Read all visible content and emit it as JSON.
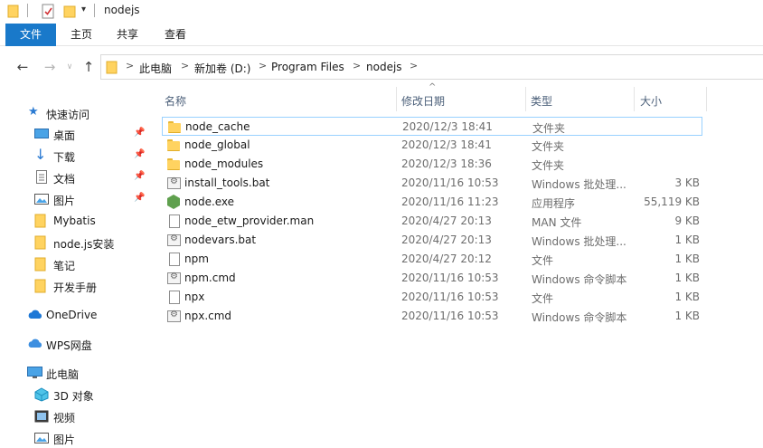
{
  "window": {
    "title": "nodejs"
  },
  "ribbon": {
    "tabs": [
      {
        "label": "文件"
      },
      {
        "label": "主页"
      },
      {
        "label": "共享"
      },
      {
        "label": "查看"
      }
    ]
  },
  "address": {
    "crumbs": [
      "此电脑",
      "新加卷 (D:)",
      "Program Files",
      "nodejs"
    ],
    "separator": ">"
  },
  "nav": {
    "quick_access": "快速访问",
    "items": [
      {
        "label": "桌面",
        "icon": "desktop-icon",
        "pinned": true
      },
      {
        "label": "下载",
        "icon": "download-icon",
        "pinned": true
      },
      {
        "label": "文档",
        "icon": "documents-icon",
        "pinned": true
      },
      {
        "label": "图片",
        "icon": "pictures-icon",
        "pinned": true
      },
      {
        "label": "Mybatis",
        "icon": "folder-icon",
        "pinned": false
      },
      {
        "label": "node.js安装",
        "icon": "folder-icon",
        "pinned": false
      },
      {
        "label": "笔记",
        "icon": "folder-icon",
        "pinned": false
      },
      {
        "label": "开发手册",
        "icon": "folder-icon",
        "pinned": false
      }
    ],
    "onedrive": "OneDrive",
    "wps": "WPS网盘",
    "this_pc": "此电脑",
    "pc_items": [
      {
        "label": "3D 对象",
        "icon": "3d-objects-icon"
      },
      {
        "label": "视频",
        "icon": "videos-icon"
      },
      {
        "label": "图片",
        "icon": "pictures-icon"
      }
    ]
  },
  "columns": {
    "name": "名称",
    "date": "修改日期",
    "type": "类型",
    "size": "大小",
    "sort_caret": "^"
  },
  "files": [
    {
      "name": "node_cache",
      "date": "2020/12/3 18:41",
      "type": "文件夹",
      "size": "",
      "icon": "folder-icon",
      "selected": true
    },
    {
      "name": "node_global",
      "date": "2020/12/3 18:41",
      "type": "文件夹",
      "size": "",
      "icon": "folder-icon"
    },
    {
      "name": "node_modules",
      "date": "2020/12/3 18:36",
      "type": "文件夹",
      "size": "",
      "icon": "folder-icon"
    },
    {
      "name": "install_tools.bat",
      "date": "2020/11/16 10:53",
      "type": "Windows 批处理...",
      "size": "3 KB",
      "icon": "batch-file-icon"
    },
    {
      "name": "node.exe",
      "date": "2020/11/16 11:23",
      "type": "应用程序",
      "size": "55,119 KB",
      "icon": "node-exe-icon"
    },
    {
      "name": "node_etw_provider.man",
      "date": "2020/4/27 20:13",
      "type": "MAN 文件",
      "size": "9 KB",
      "icon": "file-icon"
    },
    {
      "name": "nodevars.bat",
      "date": "2020/4/27 20:13",
      "type": "Windows 批处理...",
      "size": "1 KB",
      "icon": "batch-file-icon"
    },
    {
      "name": "npm",
      "date": "2020/4/27 20:12",
      "type": "文件",
      "size": "1 KB",
      "icon": "file-icon"
    },
    {
      "name": "npm.cmd",
      "date": "2020/11/16 10:53",
      "type": "Windows 命令脚本",
      "size": "1 KB",
      "icon": "cmd-file-icon"
    },
    {
      "name": "npx",
      "date": "2020/11/16 10:53",
      "type": "文件",
      "size": "1 KB",
      "icon": "file-icon"
    },
    {
      "name": "npx.cmd",
      "date": "2020/11/16 10:53",
      "type": "Windows 命令脚本",
      "size": "1 KB",
      "icon": "cmd-file-icon"
    }
  ],
  "colors": {
    "accent": "#1979ca",
    "selection_border": "#99d1ff",
    "folder": "#ffd360"
  }
}
